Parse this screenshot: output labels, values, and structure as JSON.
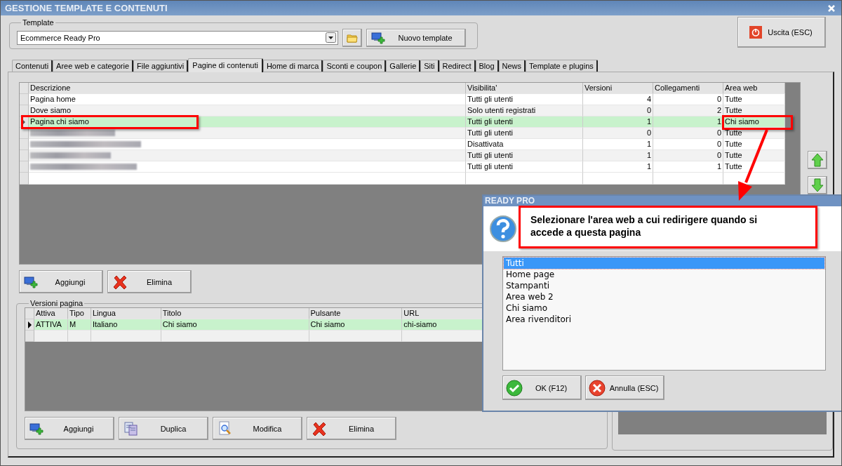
{
  "window": {
    "title": "GESTIONE TEMPLATE E CONTENUTI"
  },
  "template": {
    "label": "Template",
    "value": "Ecommerce Ready Pro",
    "new_button": "Nuovo template"
  },
  "exit_button": "Uscita (ESC)",
  "tabs": [
    {
      "label": "Contenuti",
      "selected": false
    },
    {
      "label": "Aree web e categorie",
      "selected": false
    },
    {
      "label": "File aggiuntivi",
      "selected": false
    },
    {
      "label": "Pagine di contenuti",
      "selected": true
    },
    {
      "label": "Home di marca",
      "selected": false
    },
    {
      "label": "Sconti e coupon",
      "selected": false
    },
    {
      "label": "Gallerie",
      "selected": false
    },
    {
      "label": "Siti",
      "selected": false
    },
    {
      "label": "Redirect",
      "selected": false
    },
    {
      "label": "Blog",
      "selected": false
    },
    {
      "label": "News",
      "selected": false
    },
    {
      "label": "Template e plugins",
      "selected": false
    }
  ],
  "pages_table": {
    "columns": [
      "Descrizione",
      "Visibilita'",
      "Versioni",
      "Collegamenti",
      "Area web"
    ],
    "rows": [
      {
        "description": "Pagina home",
        "blurred": false,
        "visibility": "Tutti gli utenti",
        "versions": "4",
        "links": "0",
        "area": "Tutte",
        "selected": false
      },
      {
        "description": "Dove siamo",
        "blurred": false,
        "visibility": "Solo utenti registrati",
        "versions": "0",
        "links": "2",
        "area": "Tutte",
        "selected": false
      },
      {
        "description": "Pagina chi siamo",
        "blurred": false,
        "visibility": "Tutti gli utenti",
        "versions": "1",
        "links": "1",
        "area": "Chi siamo",
        "selected": true
      },
      {
        "blurred": true,
        "visibility": "Tutti gli utenti",
        "versions": "0",
        "links": "0",
        "area": "Tutte",
        "selected": false
      },
      {
        "blurred": true,
        "visibility": "Disattivata",
        "versions": "1",
        "links": "0",
        "area": "Tutte",
        "selected": false
      },
      {
        "blurred": true,
        "visibility": "Tutti gli utenti",
        "versions": "1",
        "links": "0",
        "area": "Tutte",
        "selected": false
      },
      {
        "blurred": true,
        "visibility": "Tutti gli utenti",
        "versions": "1",
        "links": "1",
        "area": "Tutte",
        "selected": false
      }
    ]
  },
  "pages_buttons": [
    "Aggiungi",
    "Elimina"
  ],
  "versions": {
    "label": "Versioni pagina",
    "columns": [
      "Attiva",
      "Tipo",
      "Lingua",
      "Titolo",
      "Pulsante",
      "URL"
    ],
    "rows": [
      {
        "cells": [
          "ATTIVA",
          "M",
          "Italiano",
          "Chi siamo",
          "Chi siamo",
          "chi-siamo"
        ],
        "selected": true
      }
    ],
    "buttons": [
      "Aggiungi",
      "Duplica",
      "Modifica",
      "Elimina"
    ]
  },
  "dialog": {
    "title": "READY PRO",
    "message": "Selezionare l'area web a cui redirigere quando si accede a questa pagina",
    "items": [
      {
        "label": "Tutti",
        "selected": true
      },
      {
        "label": "Home page",
        "selected": false
      },
      {
        "label": "Stampanti",
        "selected": false
      },
      {
        "label": "Area web 2",
        "selected": false
      },
      {
        "label": "Chi siamo",
        "selected": false
      },
      {
        "label": "Area rivenditori",
        "selected": false
      }
    ],
    "ok_button": "OK (F12)",
    "cancel_button": "Annulla (ESC)"
  }
}
